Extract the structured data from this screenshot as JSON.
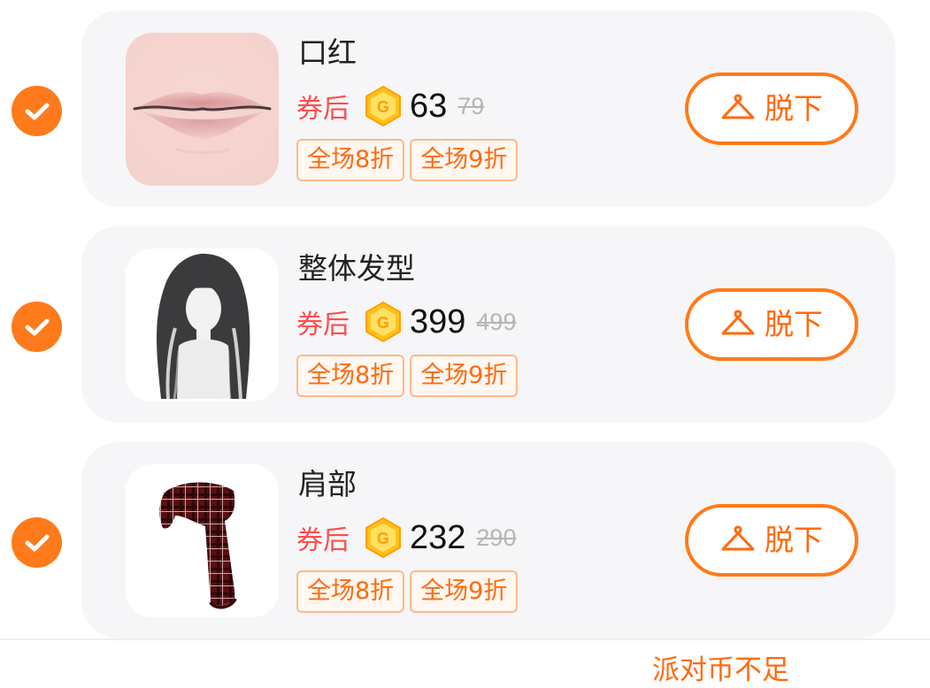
{
  "items": [
    {
      "name": "口红",
      "after_coupon_label": "券后",
      "price": "63",
      "original_price": "79",
      "tags": [
        "全场8折",
        "全场9折"
      ],
      "action_label": "脱下",
      "thumbnail": "lips-image",
      "selected": true
    },
    {
      "name": "整体发型",
      "after_coupon_label": "券后",
      "price": "399",
      "original_price": "499",
      "tags": [
        "全场8折",
        "全场9折"
      ],
      "action_label": "脱下",
      "thumbnail": "hairstyle-image",
      "selected": true
    },
    {
      "name": "肩部",
      "after_coupon_label": "券后",
      "price": "232",
      "original_price": "290",
      "tags": [
        "全场8折",
        "全场9折"
      ],
      "action_label": "脱下",
      "thumbnail": "plaid-scarf-image",
      "selected": true
    }
  ],
  "footer": {
    "status_text": "派对币不足"
  },
  "colors": {
    "accent": "#ff7a1a",
    "price_label": "#ff4d4f",
    "card_background": "#f6f6f8",
    "coin": "#ffc21a"
  },
  "icons": {
    "check": "check-icon",
    "coin": "coin-icon",
    "hanger": "hanger-icon"
  }
}
